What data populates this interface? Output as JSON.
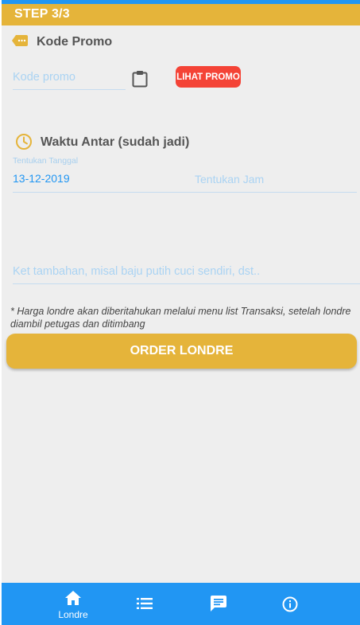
{
  "step": {
    "label": "STEP 3/3"
  },
  "promo": {
    "title": "Kode Promo",
    "input_placeholder": "Kode promo",
    "input_value": "",
    "lihat_promo_label": "LIHAT PROMO"
  },
  "delivery": {
    "title": "Waktu Antar (sudah jadi)",
    "date_caption": "Tentukan Tanggal",
    "date_value": "13-12-2019",
    "time_placeholder": "Tentukan Jam"
  },
  "notes": {
    "placeholder": "Ket tambahan, misal baju putih cuci sendiri, dst..",
    "value": "",
    "disclaimer": "* Harga londre akan diberitahukan melalui menu list Transaksi, setelah londre diambil petugas dan ditimbang"
  },
  "order": {
    "label": "ORDER LONDRE"
  },
  "bottom_nav": {
    "items": [
      {
        "icon": "home-icon",
        "label": "Londre"
      },
      {
        "icon": "list-icon",
        "label": ""
      },
      {
        "icon": "chat-icon",
        "label": ""
      },
      {
        "icon": "info-icon",
        "label": ""
      }
    ]
  },
  "colors": {
    "primary": "#2196f3",
    "accent": "#e5b43a",
    "danger": "#f44336",
    "background": "#eeeeee"
  }
}
